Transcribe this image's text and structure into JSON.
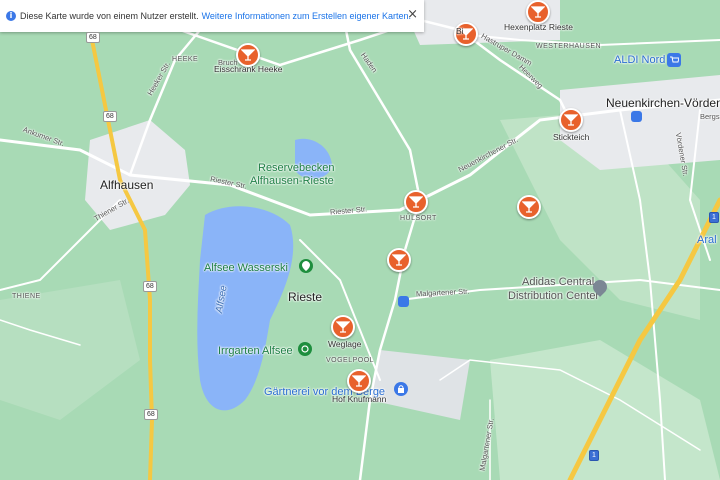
{
  "banner": {
    "info_icon": "i",
    "text": "Diese Karte wurde von einem Nutzer erstellt.",
    "link": "Weitere Informationen zum Erstellen eigener Karten.",
    "close": "×"
  },
  "places": {
    "alfhausen": "Alfhausen",
    "rieste": "Rieste",
    "neuenkirchen": "Neuenkirchen-Vörden",
    "reservebecken_1": "Reservebecken",
    "reservebecken_2": "Alfhausen-Rieste",
    "alfsee_wasserski": "Alfsee Wasserski",
    "irrgarten": "Irrgarten Alfsee",
    "gaertnerei": "Gärtnerei vor dem Berge",
    "adidas_1": "Adidas Central",
    "adidas_2": "Distribution Center",
    "aldi": "ALDI Nord",
    "alfsee": "Alfsee",
    "aral": "Aral"
  },
  "localities": {
    "heeke": "HEEKE",
    "westerhausen": "WESTERHAUSEN",
    "huelsort": "HÜLSORT",
    "thiene": "THIENE",
    "vogelpool": "VOGELPOOL"
  },
  "roads": {
    "heeker": "Heeker Str.",
    "ankumer": "Ankumer Str.",
    "thiener": "Thiener Str.",
    "riester_1": "Riester Str.",
    "riester_2": "Riester Str.",
    "hastruper": "Hastruper Damm",
    "heerweg": "Heerweg",
    "haden": "Haden",
    "neuenkirchener": "Neuenkirchener Str.",
    "malgartener": "Malgartener Str.",
    "bergs": "Bergs",
    "voerdener": "Vördener Str.",
    "gartener": "Malgartener Str.",
    "bruch": "Bruch"
  },
  "shields": {
    "b68_a": "68",
    "b68_b": "68",
    "b68_c": "68",
    "b68_d": "68",
    "a1_a": "1",
    "a1_b": "1"
  },
  "markers": [
    {
      "label": "Eisschrank Heeke",
      "icon": "cocktail-glass"
    },
    {
      "label": "Hexenplatz Rieste",
      "icon": "cocktail-glass"
    },
    {
      "label": "Bi",
      "icon": "cocktail-glass"
    },
    {
      "label": "Stickteich",
      "icon": "cocktail-glass"
    },
    {
      "label": "",
      "icon": "cocktail-glass"
    },
    {
      "label": "",
      "icon": "cocktail-glass"
    },
    {
      "label": "",
      "icon": "cocktail-glass"
    },
    {
      "label": "Weglage",
      "icon": "cocktail-glass"
    },
    {
      "label": "Hof Knufmann",
      "icon": "cocktail-glass"
    }
  ],
  "colors": {
    "land": "#a8dab5",
    "town": "#e8eaed",
    "water": "#8ab4f8",
    "road": "#ffffff",
    "highway": "#f5c842",
    "marker": "#e8612c"
  }
}
